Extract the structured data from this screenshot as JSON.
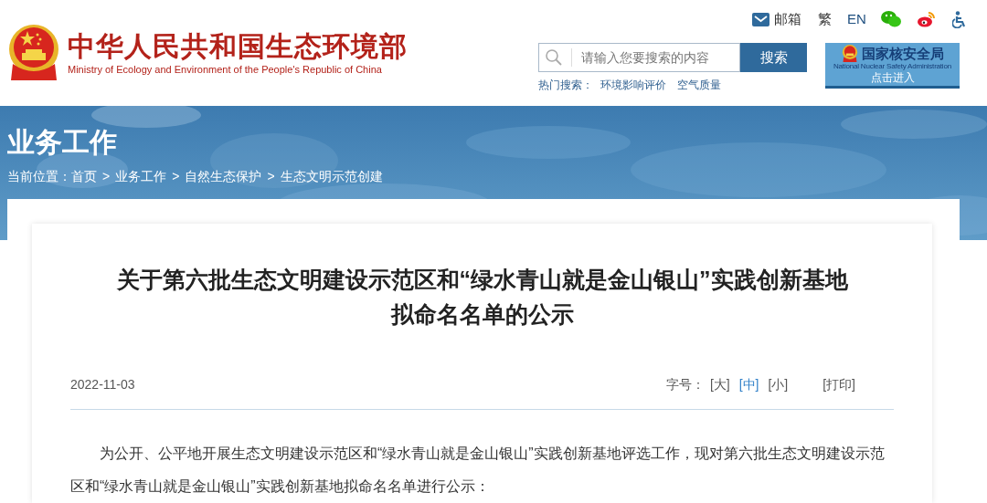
{
  "header": {
    "title": "中华人民共和国生态环境部",
    "subtitle": "Ministry of Ecology and Environment of the People's Republic of China"
  },
  "top_links": [
    {
      "kind": "mail",
      "label": "邮箱"
    },
    {
      "kind": "text",
      "label": "繁"
    },
    {
      "kind": "text",
      "label": "EN"
    },
    {
      "kind": "wechat"
    },
    {
      "kind": "weibo"
    },
    {
      "kind": "accessibility"
    }
  ],
  "search": {
    "placeholder": "请输入您要搜索的内容",
    "button": "搜索",
    "hot_label": "热门搜索：",
    "hot_items": [
      "环境影响评价",
      "空气质量"
    ]
  },
  "nnsa_banner": {
    "title": "国家核安全局",
    "subtitle": "National Nuclear Safety Administration",
    "action": "点击进入"
  },
  "section": {
    "title": "业务工作",
    "breadcrumb": [
      {
        "kind": "label",
        "text": "当前位置："
      },
      {
        "kind": "link",
        "text": "首页"
      },
      {
        "kind": "separator",
        "text": ">"
      },
      {
        "kind": "link",
        "text": "业务工作"
      },
      {
        "kind": "separator",
        "text": ">"
      },
      {
        "kind": "link",
        "text": "自然生态保护"
      },
      {
        "kind": "separator",
        "text": ">"
      },
      {
        "kind": "link",
        "text": "生态文明示范创建"
      }
    ]
  },
  "article": {
    "title_lines": [
      "关于第六批生态文明建设示范区和“绿水青山就是金山银山”实践创新基地",
      "拟命名名单的公示"
    ],
    "date": "2022-11-03",
    "font_size_label": "字号：",
    "font_sizes": [
      {
        "label": "[大]",
        "selected": false
      },
      {
        "label": "[中]",
        "selected": true
      },
      {
        "label": "[小]",
        "selected": false
      }
    ],
    "print": "[打印]",
    "body": "为公开、公平地开展生态文明建设示范区和“绿水青山就是金山银山”实践创新基地评选工作，现对第六批生态文明建设示范区和“绿水青山就是金山银山”实践创新基地拟命名名单进行公示："
  }
}
